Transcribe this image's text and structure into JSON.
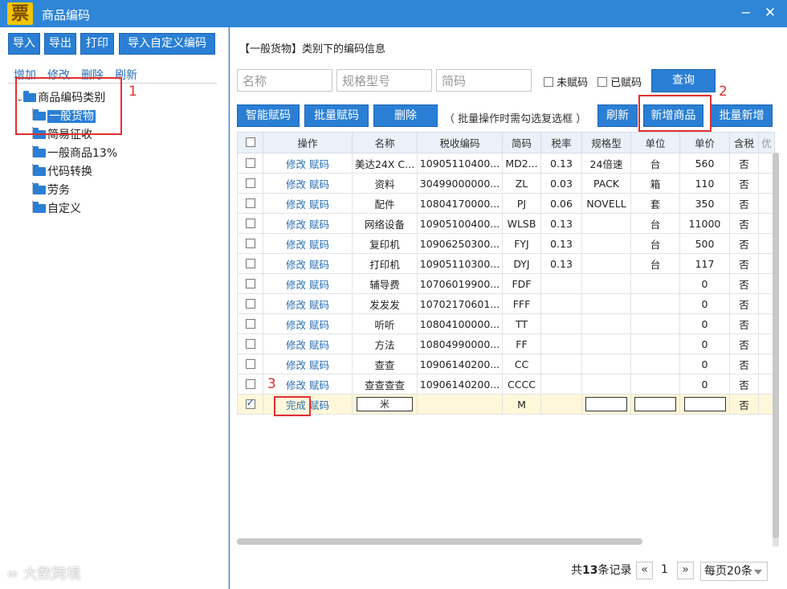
{
  "window": {
    "title": "商品编码",
    "logo_char": "票",
    "minimize": "−",
    "close": "✕"
  },
  "left": {
    "buttons": [
      "导入",
      "导出",
      "打印",
      "导入自定义编码"
    ],
    "links": [
      "增加",
      "修改",
      "删除",
      "刷新"
    ],
    "tree": {
      "root": "商品编码类别",
      "children": [
        "一般货物",
        "简易征收",
        "一般商品13%",
        "代码转换",
        "劳务",
        "自定义"
      ],
      "selected": "一般货物"
    },
    "annotation": "1"
  },
  "right": {
    "header": "【一般货物】类别下的编码信息",
    "search": {
      "name_placeholder": "名称",
      "spec_placeholder": "规格型号",
      "code_placeholder": "简码",
      "unassigned": "未赋码",
      "assigned": "已赋码",
      "query": "查询"
    },
    "toolbar": {
      "smart": "智能赋码",
      "batch": "批量赋码",
      "delete": "删除",
      "hint": "（ 批量操作时需勾选复选框 ）",
      "refresh": "刷新",
      "add": "新增商品",
      "batch_add": "批量新增"
    },
    "annotation_add": "2",
    "annotation_done": "3",
    "columns": [
      "操作",
      "名称",
      "税收编码",
      "简码",
      "税率",
      "规格型",
      "单位",
      "单价",
      "含税",
      "优"
    ],
    "op_edit": "修改",
    "op_code": "赋码",
    "op_done": "完成",
    "rows": [
      [
        "美达24X C...",
        "10905110400...",
        "MD2...",
        "0.13",
        "24倍速",
        "台",
        "560",
        "否"
      ],
      [
        "资料",
        "30499000000...",
        "ZL",
        "0.03",
        "PACK",
        "箱",
        "110",
        "否"
      ],
      [
        "配件",
        "10804170000...",
        "PJ",
        "0.06",
        "NOVELL",
        "套",
        "350",
        "否"
      ],
      [
        "网络设备",
        "10905100400...",
        "WLSB",
        "0.13",
        "",
        "台",
        "11000",
        "否"
      ],
      [
        "复印机",
        "10906250300...",
        "FYJ",
        "0.13",
        "",
        "台",
        "500",
        "否"
      ],
      [
        "打印机",
        "10905110300...",
        "DYJ",
        "0.13",
        "",
        "台",
        "117",
        "否"
      ],
      [
        "辅导费",
        "10706019900...",
        "FDF",
        "",
        "",
        "",
        "0",
        "否"
      ],
      [
        "发发发",
        "10702170601...",
        "FFF",
        "",
        "",
        "",
        "0",
        "否"
      ],
      [
        "听听",
        "10804100000...",
        "TT",
        "",
        "",
        "",
        "0",
        "否"
      ],
      [
        "方法",
        "10804990000...",
        "FF",
        "",
        "",
        "",
        "0",
        "否"
      ],
      [
        "查查",
        "10906140200...",
        "CC",
        "",
        "",
        "",
        "0",
        "否"
      ],
      [
        "查查查查",
        "10906140200...",
        "CCCC",
        "",
        "",
        "",
        "0",
        "否"
      ]
    ],
    "edit_row": {
      "name_value": "米",
      "code": "M",
      "tax_included": "否"
    },
    "pager": {
      "total_prefix": "共",
      "total_count": "13",
      "total_suffix": "条记录",
      "prev": "«",
      "page": "1",
      "next": "»",
      "page_size": "每页20条"
    }
  },
  "watermark": "大数跨境"
}
